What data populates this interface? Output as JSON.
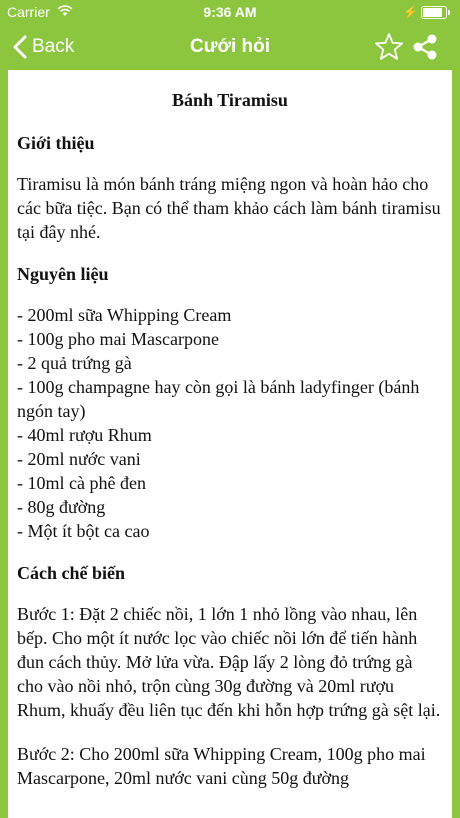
{
  "status_bar": {
    "carrier": "Carrier",
    "time": "9:36 AM"
  },
  "nav": {
    "back_label": "Back",
    "title": "Cưới hỏi"
  },
  "article": {
    "title": "Bánh Tiramisu",
    "intro_heading": "Giới thiệu",
    "intro_text": "Tiramisu là món bánh tráng miệng ngon và hoàn hảo cho các bữa tiệc. Bạn có thể tham khảo cách làm bánh tiramisu tại đây nhé.",
    "ingredients_heading": "Nguyên liệu",
    "ingredients": [
      "- 200ml sữa Whipping Cream",
      "- 100g pho mai Mascarpone",
      "- 2 quả trứng gà",
      "- 100g champagne hay còn gọi là bánh ladyfinger (bánh ngón tay)",
      "- 40ml rượu Rhum",
      "- 20ml nước vani",
      "- 10ml cà phê đen",
      "- 80g đường",
      "- Một ít bột ca cao"
    ],
    "method_heading": "Cách chế biến",
    "steps": [
      "Bước 1: Đặt 2 chiếc nồi, 1 lớn 1 nhỏ lồng vào nhau, lên bếp. Cho một ít nước lọc vào chiếc nồi lớn để tiến hành đun cách thủy. Mở lửa vừa. Đập lấy 2 lòng đỏ trứng gà cho vào nồi nhỏ, trộn cùng 30g đường và 20ml rượu Rhum, khuấy đều liên tục đến khi hỗn hợp trứng gà sệt lại.",
      "Bước 2: Cho 200ml sữa Whipping Cream, 100g pho mai Mascarpone, 20ml nước vani cùng 50g đường"
    ]
  },
  "colors": {
    "header_green": "#8cc63e",
    "content_bg": "#ffffff"
  },
  "icons": {
    "back": "chevron-left-icon",
    "favorite": "star-outline-icon",
    "share": "share-icon",
    "wifi": "wifi-icon",
    "battery": "battery-icon"
  }
}
